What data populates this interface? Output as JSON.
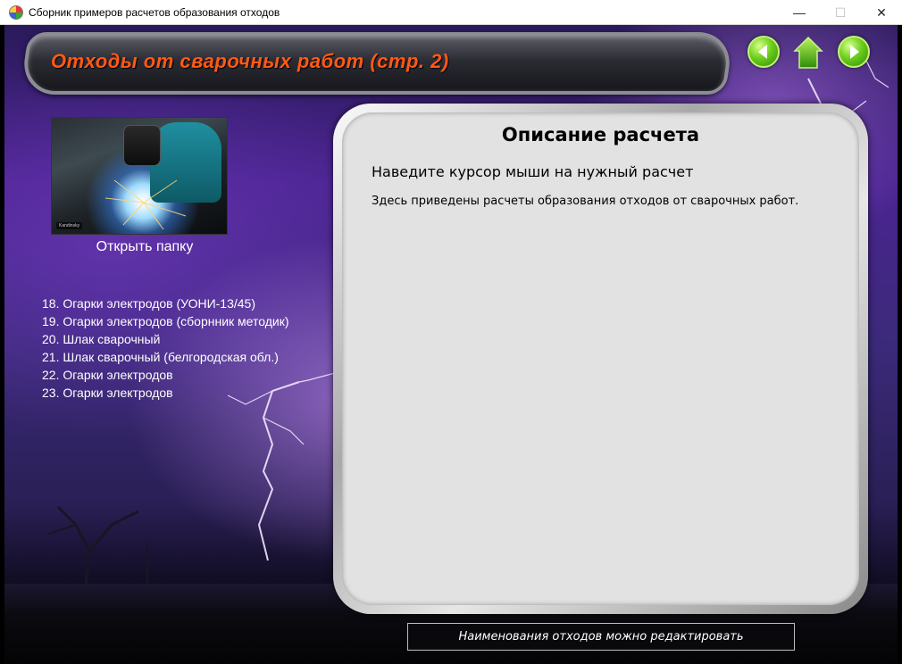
{
  "window": {
    "title": "Сборник примеров расчетов образования отходов",
    "minimize": "—",
    "maximize": "☐",
    "close": "✕"
  },
  "header": {
    "title": "Отходы от сварочных работ (стр. 2)"
  },
  "nav": {
    "back_icon": "arrow-left-icon",
    "home_icon": "home-icon",
    "forward_icon": "arrow-right-icon"
  },
  "left_panel": {
    "image_badge": "Kandinsky",
    "open_folder_label": "Открыть папку",
    "items": [
      "18. Огарки электродов (УОНИ-13/45)",
      "19. Огарки электродов (сборнник методик)",
      "20. Шлак сварочный",
      "21. Шлак сварочный (белгородская обл.)",
      "22. Огарки электродов",
      "23. Огарки электродов"
    ]
  },
  "description": {
    "heading": "Описание расчета",
    "subtitle": "Наведите курсор мыши на нужный расчет",
    "text": "Здесь приведены расчеты образования отходов от сварочных работ."
  },
  "footer": {
    "note": "Наименования отходов можно редактировать"
  },
  "colors": {
    "header_title": "#ff5a14",
    "nav_green": "#6ccf1c",
    "panel_bg": "#e2e2e2"
  }
}
